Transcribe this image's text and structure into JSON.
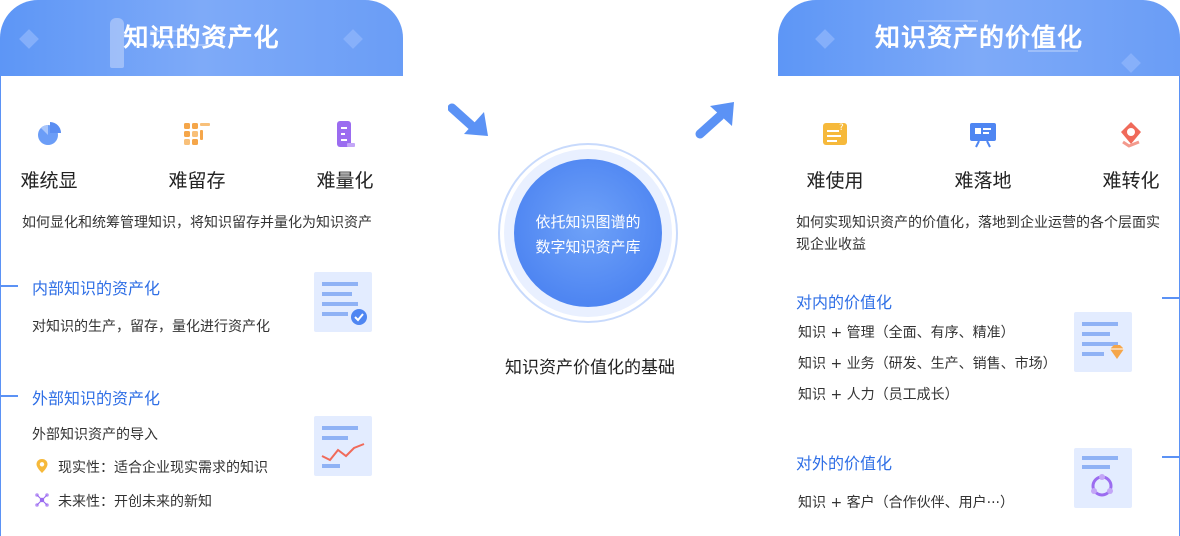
{
  "left_panel": {
    "title": "知识的资产化",
    "difficulties": [
      {
        "label": "难统显",
        "icon": "pie-chart-icon"
      },
      {
        "label": "难留存",
        "icon": "grid-blocks-icon"
      },
      {
        "label": "难量化",
        "icon": "measure-icon"
      }
    ],
    "description": "如何显化和统筹管理知识，将知识留存并量化为知识资产",
    "internal": {
      "title": "内部知识的资产化",
      "text": "对知识的生产，留存，量化进行资产化"
    },
    "external": {
      "title": "外部知识的资产化",
      "intro": "外部知识资产的导入",
      "items": [
        {
          "text": "现实性：适合企业现实需求的知识",
          "icon": "location-pin-icon"
        },
        {
          "text": "未来性：开创未来的新知",
          "icon": "network-icon"
        }
      ]
    }
  },
  "center": {
    "circle_text_line1": "依托知识图谱的",
    "circle_text_line2": "数字知识资产库",
    "caption": "知识资产价值化的基础"
  },
  "right_panel": {
    "title": "知识资产的价值化",
    "difficulties": [
      {
        "label": "难使用",
        "icon": "question-doc-icon"
      },
      {
        "label": "难落地",
        "icon": "presentation-board-icon"
      },
      {
        "label": "难转化",
        "icon": "exchange-hand-icon"
      }
    ],
    "description": "如何实现知识资产的价值化，落地到企业运营的各个层面实现企业收益",
    "internal": {
      "title": "对内的价值化",
      "items": [
        "知识 + 管理（全面、有序、精准）",
        "知识 + 业务（研发、生产、销售、市场）",
        "知识 + 人力（员工成长）"
      ]
    },
    "external": {
      "title": "对外的价值化",
      "items": [
        "知识 + 客户（合作伙伴、用户···）"
      ]
    }
  },
  "colors": {
    "accent": "#5b92f5",
    "title_blue": "#2f6fe6",
    "orange": "#f5a64a",
    "purple": "#9b6cf0",
    "red": "#f06a5a",
    "yellow": "#f6b93b"
  }
}
